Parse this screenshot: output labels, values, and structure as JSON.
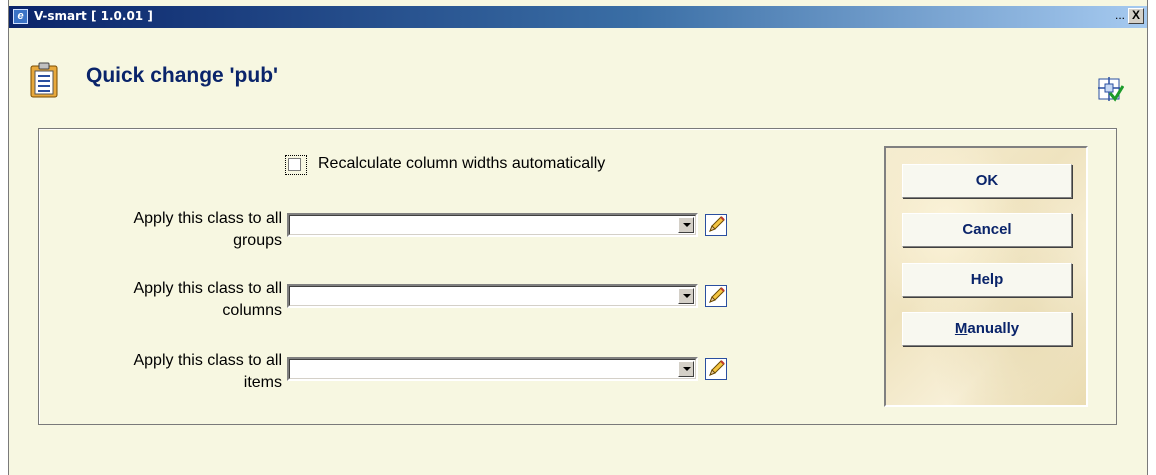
{
  "window": {
    "title": "V-smart [ 1.0.01 ]",
    "ellipsis": "...",
    "close_label": "X"
  },
  "header": {
    "title": "Quick change 'pub'"
  },
  "form": {
    "checkbox_label": "Recalculate column widths automatically",
    "checkbox_checked": false,
    "fields": [
      {
        "label_line1": "Apply this class to all",
        "label_line2": "groups",
        "value": ""
      },
      {
        "label_line1": "Apply this class to all",
        "label_line2": "columns",
        "value": ""
      },
      {
        "label_line1": "Apply this class to all",
        "label_line2": "items",
        "value": ""
      }
    ]
  },
  "buttons": {
    "ok": "OK",
    "cancel": "Cancel",
    "help": "Help",
    "manually_accel": "M",
    "manually_rest": "anually"
  },
  "icons": {
    "app": "app-icon",
    "header": "clipboard-icon",
    "layout": "layout-check-icon",
    "edit": "pencil-icon"
  },
  "colors": {
    "title_blue": "#0a246a",
    "background": "#f7f7e1"
  }
}
